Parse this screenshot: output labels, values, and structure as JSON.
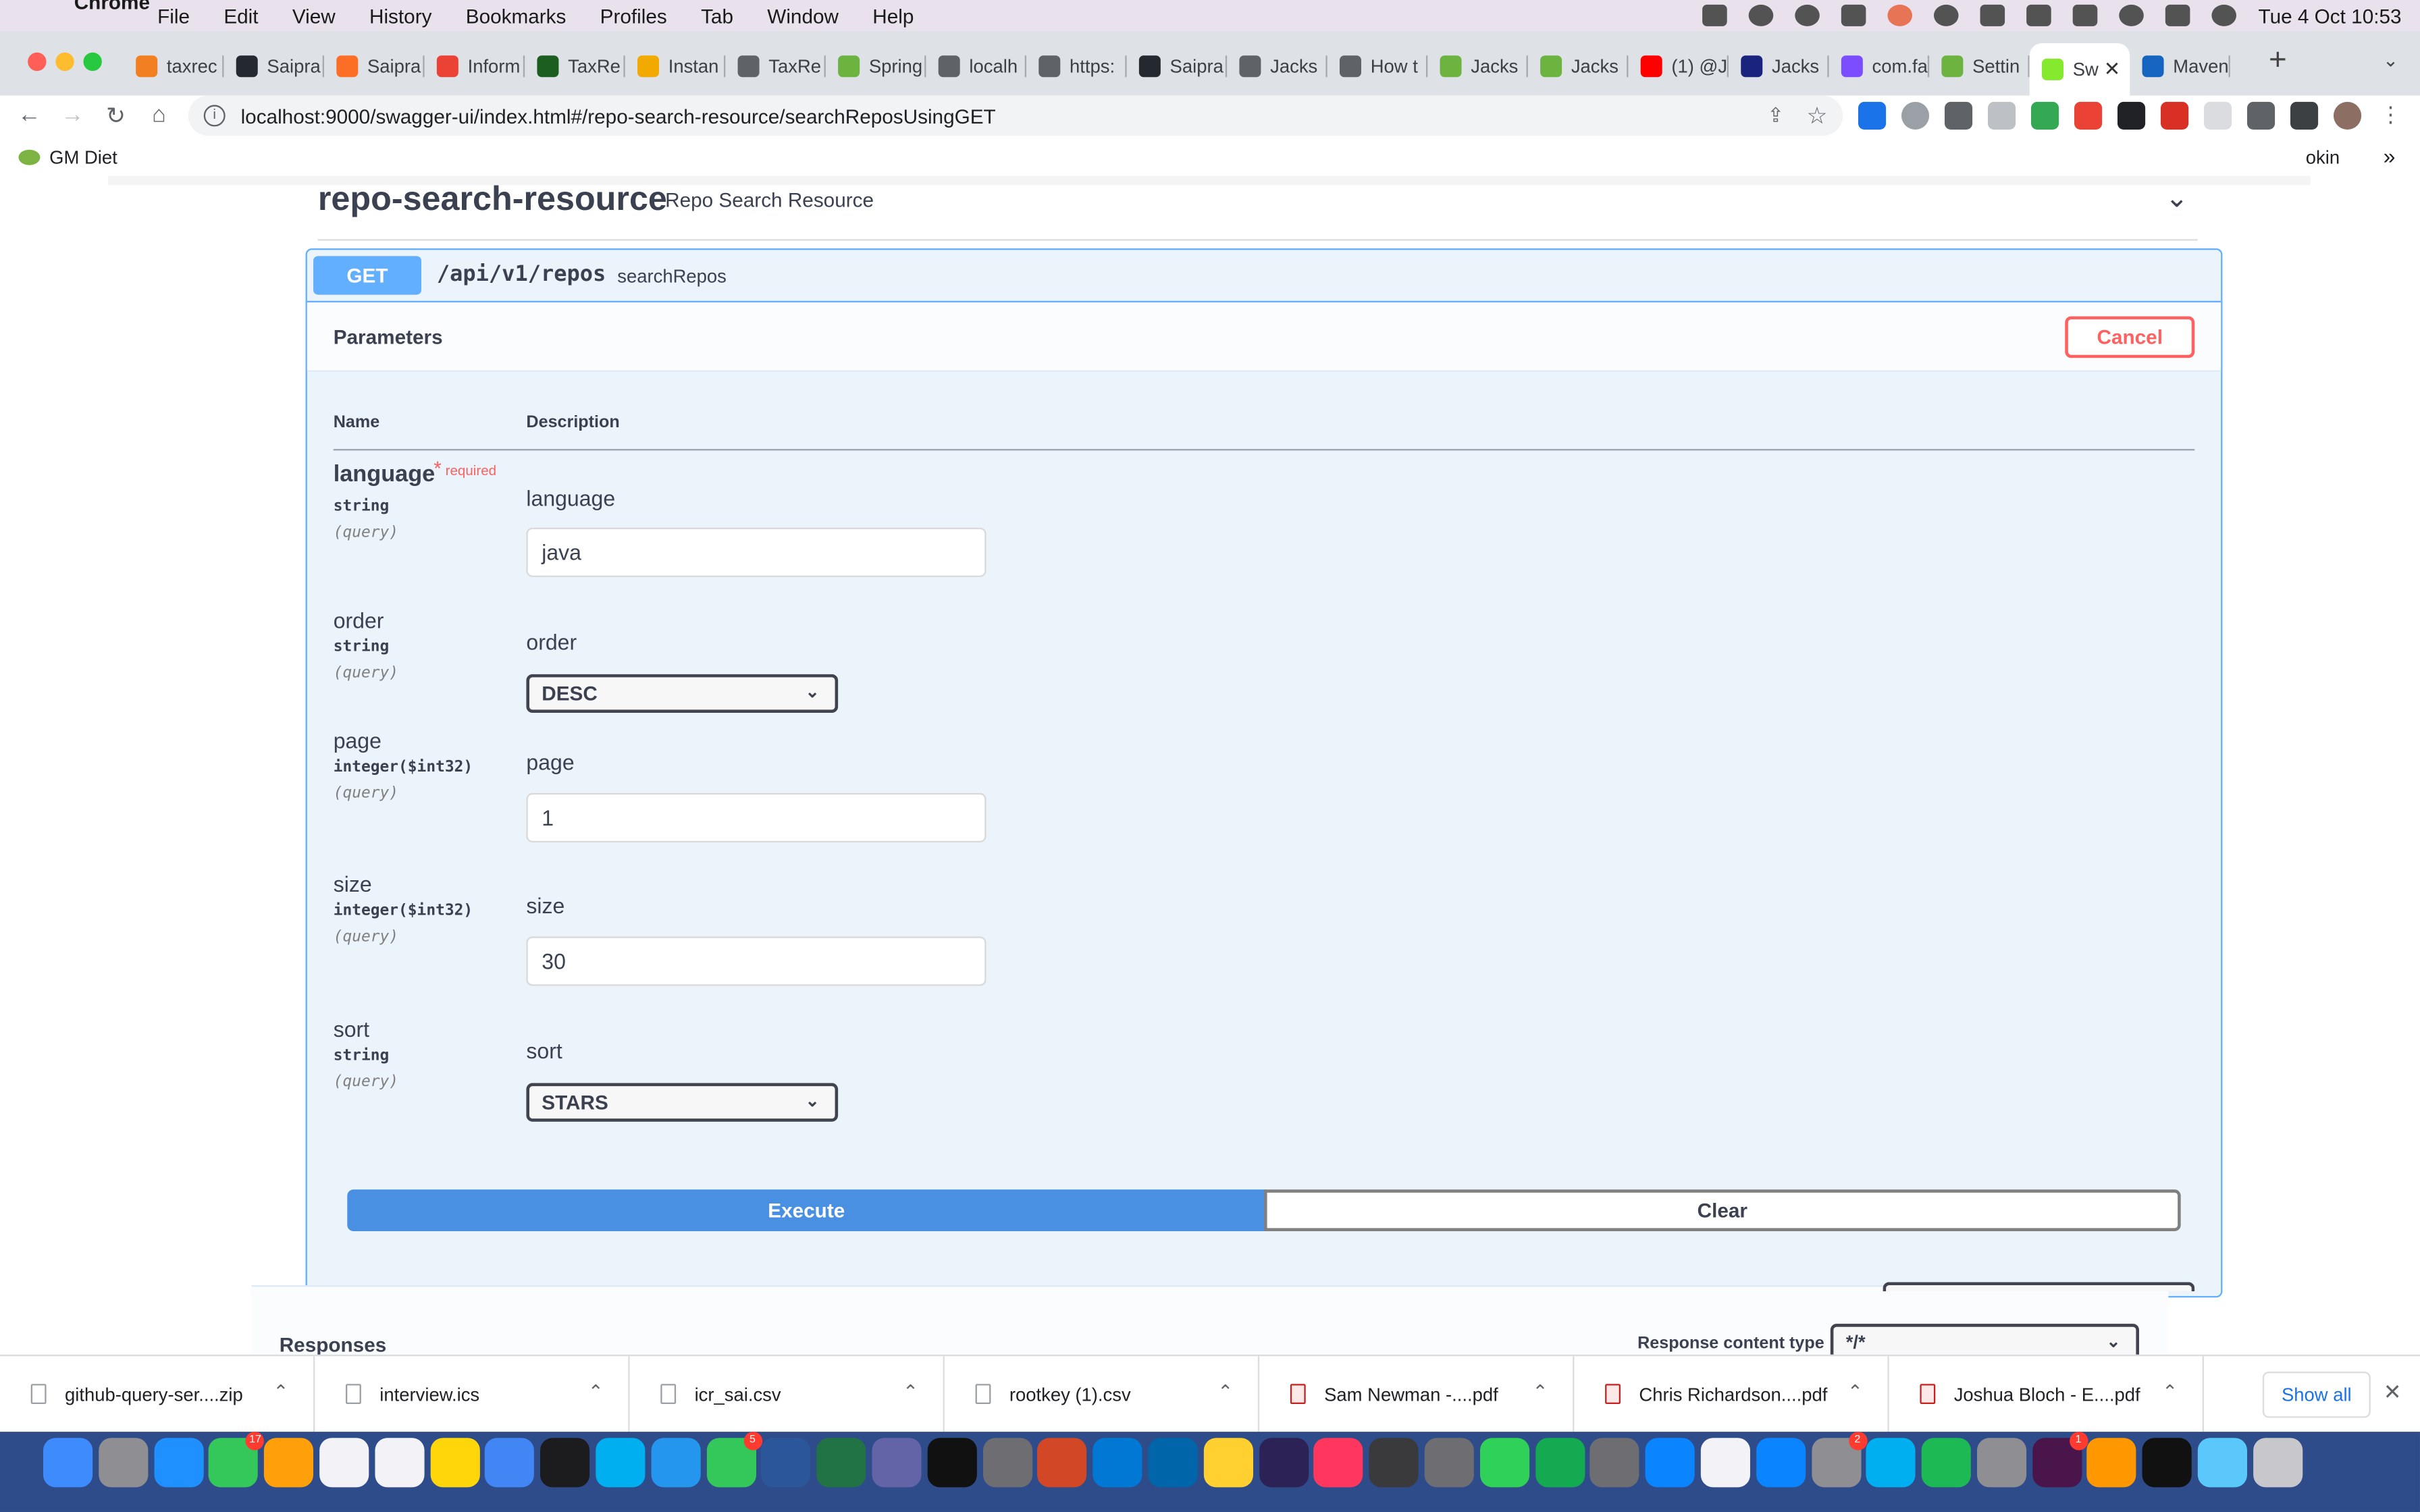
{
  "menubar": {
    "apple": "",
    "app": "Chrome",
    "items": [
      "File",
      "Edit",
      "View",
      "History",
      "Bookmarks",
      "Profiles",
      "Tab",
      "Window",
      "Help"
    ],
    "clock": "Tue 4 Oct  10:53"
  },
  "tabs": [
    {
      "label": "taxrec",
      "color": "#f38020"
    },
    {
      "label": "Saipra",
      "color": "#24292f"
    },
    {
      "label": "Saipra",
      "color": "#fc6d26"
    },
    {
      "label": "Inform",
      "color": "#ea4335"
    },
    {
      "label": "TaxRe",
      "color": "#1b5e20"
    },
    {
      "label": "Instan",
      "color": "#f2a900"
    },
    {
      "label": "TaxRe",
      "color": "#5f6368"
    },
    {
      "label": "Spring",
      "color": "#6db33f"
    },
    {
      "label": "localh",
      "color": "#5f6368"
    },
    {
      "label": "https:",
      "color": "#5f6368"
    },
    {
      "label": "Saipra",
      "color": "#24292f"
    },
    {
      "label": "Jacks",
      "color": "#5f6368"
    },
    {
      "label": "How t",
      "color": "#5f6368"
    },
    {
      "label": "Jacks",
      "color": "#6db33f"
    },
    {
      "label": "Jacks",
      "color": "#6db33f"
    },
    {
      "label": "(1) @J",
      "color": "#ff0000"
    },
    {
      "label": "Jacks",
      "color": "#1a237e"
    },
    {
      "label": "com.fa",
      "color": "#7c4dff"
    },
    {
      "label": "Settin",
      "color": "#6db33f"
    },
    {
      "label": "Sw",
      "color": "#85ea2d",
      "active": true
    },
    {
      "label": "Maven",
      "color": "#1565c0"
    }
  ],
  "address": {
    "url": "localhost:9000/swagger-ui/index.html#/repo-search-resource/searchReposUsingGET"
  },
  "bookmarks": {
    "first": "GM Diet",
    "last": "okin"
  },
  "swagger": {
    "tag": "repo-search-resource",
    "tag_description": "Repo Search Resource",
    "method": "GET",
    "path": "/api/v1/repos",
    "summary": "searchRepos",
    "parameters_title": "Parameters",
    "cancel_label": "Cancel",
    "col_name": "Name",
    "col_description": "Description",
    "required_text": "required",
    "params": [
      {
        "name": "language",
        "type": "string",
        "in": "(query)",
        "label": "language",
        "value": "java",
        "required": true,
        "kind": "input"
      },
      {
        "name": "order",
        "type": "string",
        "in": "(query)",
        "label": "order",
        "value": "DESC",
        "required": false,
        "kind": "select"
      },
      {
        "name": "page",
        "type": "integer($int32)",
        "in": "(query)",
        "label": "page",
        "value": "1",
        "required": false,
        "kind": "input"
      },
      {
        "name": "size",
        "type": "integer($int32)",
        "in": "(query)",
        "label": "size",
        "value": "30",
        "required": false,
        "kind": "input"
      },
      {
        "name": "sort",
        "type": "string",
        "in": "(query)",
        "label": "sort",
        "value": "STARS",
        "required": false,
        "kind": "select"
      }
    ],
    "execute_label": "Execute",
    "clear_label": "Clear",
    "responses_title": "Responses",
    "response_content_type_label": "Response content type",
    "response_content_type": "*/*"
  },
  "downloads": [
    {
      "file": "github-query-ser....zip",
      "pdf": false
    },
    {
      "file": "interview.ics",
      "pdf": false
    },
    {
      "file": "icr_sai.csv",
      "pdf": false
    },
    {
      "file": "rootkey (1).csv",
      "pdf": false
    },
    {
      "file": "Sam Newman -....pdf",
      "pdf": true
    },
    {
      "file": "Chris Richardson....pdf",
      "pdf": true
    },
    {
      "file": "Joshua Bloch - E....pdf",
      "pdf": true
    }
  ],
  "show_all_label": "Show all",
  "dock": {
    "apps": [
      {
        "name": "finder-icon",
        "color": "#3d8bfd"
      },
      {
        "name": "launchpad-icon",
        "color": "#8e8e93"
      },
      {
        "name": "safari-icon",
        "color": "#1e90ff"
      },
      {
        "name": "facetime-icon",
        "color": "#34c759",
        "badge": "17"
      },
      {
        "name": "photos-icon",
        "color": "#ff9f0a"
      },
      {
        "name": "calendar-icon",
        "color": "#f2f2f7"
      },
      {
        "name": "reminders-icon",
        "color": "#f2f2f7"
      },
      {
        "name": "notes-icon",
        "color": "#ffd60a"
      },
      {
        "name": "chrome-icon",
        "color": "#4285f4"
      },
      {
        "name": "terminal-icon",
        "color": "#1c1c1e"
      },
      {
        "name": "skype-icon",
        "color": "#00aff0"
      },
      {
        "name": "docker-icon",
        "color": "#2496ed"
      },
      {
        "name": "messages-icon",
        "color": "#34c759",
        "badge": "5"
      },
      {
        "name": "word-icon",
        "color": "#2b579a"
      },
      {
        "name": "excel-icon",
        "color": "#217346"
      },
      {
        "name": "teams-icon",
        "color": "#6264a7"
      },
      {
        "name": "iterm-icon",
        "color": "#111111"
      },
      {
        "name": "unknown-app-icon",
        "color": "#6d6d72"
      },
      {
        "name": "powerpoint-icon",
        "color": "#d24726"
      },
      {
        "name": "outlook-icon",
        "color": "#0078d4"
      },
      {
        "name": "vscode-icon",
        "color": "#0065a9"
      },
      {
        "name": "miro-icon",
        "color": "#ffd02f"
      },
      {
        "name": "eclipse-icon",
        "color": "#2c2255"
      },
      {
        "name": "news-icon",
        "color": "#ff375f"
      },
      {
        "name": "squirrel-icon",
        "color": "#3a3a3c"
      },
      {
        "name": "unknown-app-icon",
        "color": "#6d6d72"
      },
      {
        "name": "numbers-icon",
        "color": "#30d158"
      },
      {
        "name": "mongodb-icon",
        "color": "#13aa52"
      },
      {
        "name": "unknown-app-icon",
        "color": "#6d6d72"
      },
      {
        "name": "keynote-icon",
        "color": "#0a84ff"
      },
      {
        "name": "textedit-icon",
        "color": "#f2f2f7"
      },
      {
        "name": "app-store-icon",
        "color": "#0a84ff"
      },
      {
        "name": "system-preferences-icon",
        "color": "#8e8e93",
        "badge": "2"
      },
      {
        "name": "skype-for-business-icon",
        "color": "#00aff0"
      },
      {
        "name": "spotify-icon",
        "color": "#1db954"
      },
      {
        "name": "preview-icon",
        "color": "#8e8e93"
      },
      {
        "name": "slack-icon",
        "color": "#4a154b",
        "badge": "1"
      },
      {
        "name": "sublime-icon",
        "color": "#ff9800"
      },
      {
        "name": "intellij-icon",
        "color": "#111111"
      },
      {
        "name": "folder-icon",
        "color": "#5ac8fa"
      },
      {
        "name": "trash-icon",
        "color": "#c7c7cc"
      }
    ]
  }
}
